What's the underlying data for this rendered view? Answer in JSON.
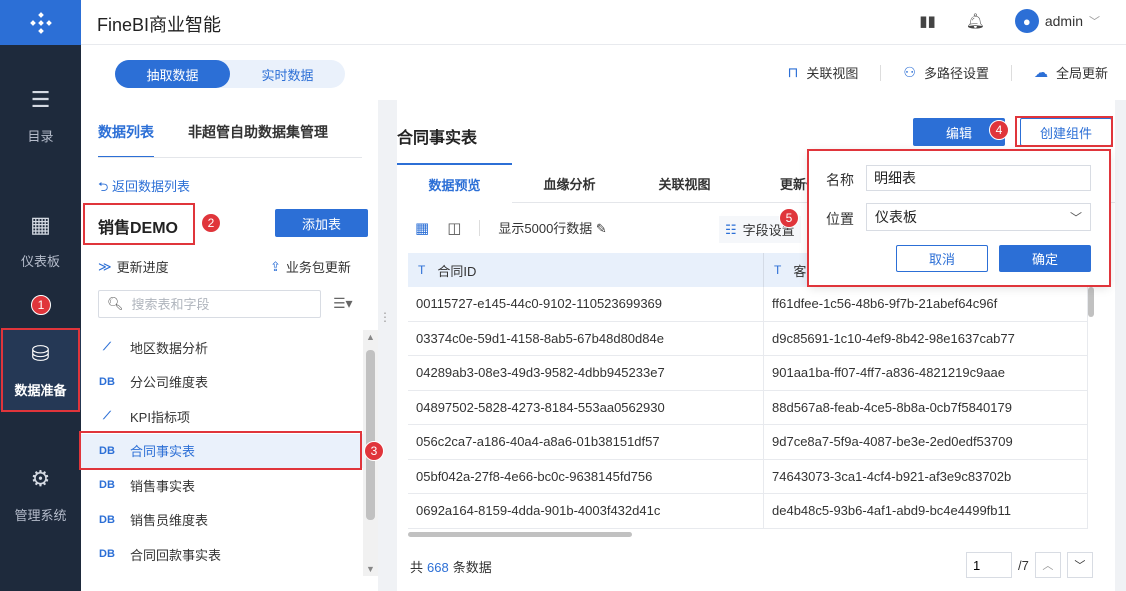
{
  "app": {
    "title": "FineBI商业智能"
  },
  "sidebar": {
    "items": [
      {
        "label": "目录",
        "icon": "list-icon"
      },
      {
        "label": "仪表板",
        "icon": "dashboard-icon"
      },
      {
        "label": "数据准备",
        "icon": "database-icon",
        "active": true
      },
      {
        "label": "管理系统",
        "icon": "gear-icon"
      }
    ]
  },
  "topbar": {
    "user": "admin",
    "icons": [
      "book-icon",
      "bell-icon"
    ]
  },
  "subbar": {
    "segments": [
      "抽取数据",
      "实时数据"
    ],
    "actions": [
      "关联视图",
      "多路径设置",
      "全局更新"
    ]
  },
  "left": {
    "tabs": [
      "数据列表",
      "非超管自助数据集管理"
    ],
    "back": "返回数据列表",
    "package": "销售DEMO",
    "add_table": "添加表",
    "update_progress": "更新进度",
    "package_update": "业务包更新",
    "search_placeholder": "搜索表和字段",
    "tables": [
      {
        "name": "地区数据分析",
        "icon": "analysis-icon"
      },
      {
        "name": "分公司维度表",
        "icon": "db-table-icon"
      },
      {
        "name": "KPI指标项",
        "icon": "analysis-icon"
      },
      {
        "name": "合同事实表",
        "icon": "db-table-icon",
        "selected": true
      },
      {
        "name": "销售事实表",
        "icon": "db-table-icon"
      },
      {
        "name": "销售员维度表",
        "icon": "db-table-icon"
      },
      {
        "name": "合同回款事实表",
        "icon": "db-table-icon"
      }
    ]
  },
  "right": {
    "title": "合同事实表",
    "edit": "编辑",
    "create_component": "创建组件",
    "tabs": [
      "数据预览",
      "血缘分析",
      "关联视图",
      "更新信"
    ],
    "show_rows": "显示5000行数据",
    "field_settings": "字段设置",
    "columns": [
      "合同ID",
      "客"
    ],
    "rows": [
      [
        "00115727-e145-44c0-9102-110523699369",
        "ff61dfee-1c56-48b6-9f7b-21abef64c96f"
      ],
      [
        "03374c0e-59d1-4158-8ab5-67b48d80d84e",
        "d9c85691-1c10-4ef9-8b42-98e1637cab77"
      ],
      [
        "04289ab3-08e3-49d3-9582-4dbb945233e7",
        "901aa1ba-ff07-4ff7-a836-4821219c9aae"
      ],
      [
        "04897502-5828-4273-8184-553aa0562930",
        "88d567a8-feab-4ce5-8b8a-0cb7f5840179"
      ],
      [
        "056c2ca7-a186-40a4-a8a6-01b38151df57",
        "9d7ce8a7-5f9a-4087-be3e-2ed0edf53709"
      ],
      [
        "05bf042a-27f8-4e66-bc0c-9638145fd756",
        "74643073-3ca1-4cf4-b921-af3e9c83702b"
      ],
      [
        "0692a164-8159-4dda-901b-4003f432d41c",
        "de4b48c5-93b6-4af1-abd9-bc4e4499fb11"
      ]
    ],
    "total_prefix": "共",
    "total_count": "668",
    "total_suffix": "条数据",
    "page_current": "1",
    "page_total": "/7"
  },
  "popup": {
    "name_label": "名称",
    "name_value": "明细表",
    "position_label": "位置",
    "position_value": "仪表板",
    "cancel": "取消",
    "confirm": "确定"
  },
  "annotations": [
    "1",
    "2",
    "3",
    "4",
    "5"
  ],
  "colors": {
    "accent": "#2c6fd6",
    "sidebar": "#1e2a3c",
    "highlight": "#e0353b"
  }
}
